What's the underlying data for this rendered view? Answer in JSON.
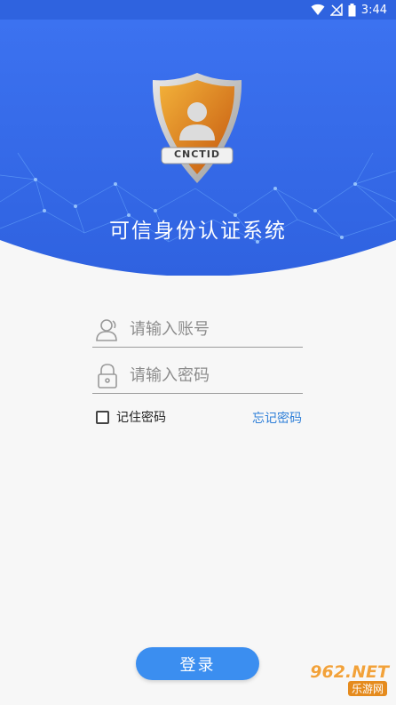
{
  "status_bar": {
    "time": "3:44",
    "icons": [
      "wifi-icon",
      "signal-off-icon",
      "battery-icon"
    ]
  },
  "header": {
    "title": "可信身份认证系统",
    "badge_text": "CNCTID"
  },
  "form": {
    "account_placeholder": "请输入账号",
    "password_placeholder": "请输入密码",
    "remember_label": "记住密码",
    "remember_checked": false,
    "forgot_label": "忘记密码"
  },
  "login_button": "登录",
  "watermark": {
    "top": "962.NET",
    "bottom": "乐游网"
  },
  "colors": {
    "primary": "#3b8ef0",
    "header_blue": "#2f63df",
    "link": "#2e7fd8",
    "background": "#f7f7f7"
  }
}
